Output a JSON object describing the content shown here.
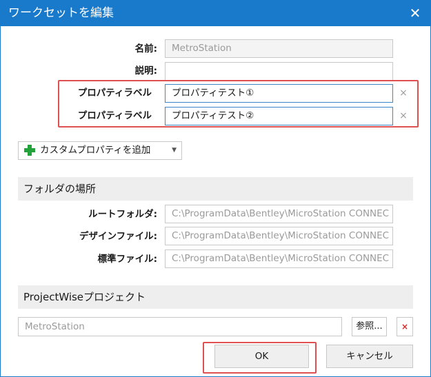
{
  "window": {
    "title": "ワークセットを編集",
    "close_glyph": "✕"
  },
  "form": {
    "name_label": "名前:",
    "name_value": "MetroStation",
    "desc_label": "説明:",
    "desc_value": ""
  },
  "custom_properties": [
    {
      "label": "プロパティラベル",
      "value": "プロパティテスト①",
      "remove_glyph": "×"
    },
    {
      "label": "プロパティラベル",
      "value": "プロパティテスト②",
      "remove_glyph": "×"
    }
  ],
  "add_property_button": {
    "label": "カスタムプロパティを追加",
    "dropdown_glyph": "▼",
    "icon": "plus-icon",
    "icon_color": "#22a33a"
  },
  "folders": {
    "section_title": "フォルダの場所",
    "root_label": "ルートフォルダ:",
    "root_value": "C:\\ProgramData\\Bentley\\MicroStation CONNEC",
    "design_label": "デザインファイル:",
    "design_value": "C:\\ProgramData\\Bentley\\MicroStation CONNEC",
    "standard_label": "標準ファイル:",
    "standard_value": "C:\\ProgramData\\Bentley\\MicroStation CONNEC"
  },
  "projectwise": {
    "section_title": "ProjectWiseプロジェクト",
    "project_value": "MetroStation",
    "browse_label": "参照...",
    "clear_glyph": "×"
  },
  "footer": {
    "ok_label": "OK",
    "cancel_label": "キャンセル"
  },
  "colors": {
    "titlebar": "#1979ca",
    "highlight": "#e05050",
    "section_bg": "#eeeeee"
  }
}
